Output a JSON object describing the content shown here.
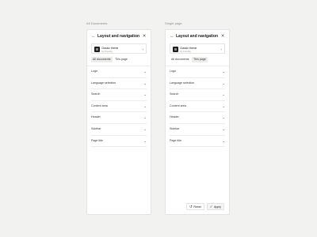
{
  "captions": {
    "left": "All Documents",
    "right": "Single page"
  },
  "panel": {
    "title": "Layout and navigation",
    "back_icon": "arrow-left-icon",
    "close_icon": "close-icon",
    "theme": {
      "name": "Classic theme",
      "author": "by Fouday"
    },
    "tabs": [
      "All documents",
      "This page"
    ],
    "rows": [
      "Logo",
      "Language selection",
      "Search",
      "Content area",
      "Header",
      "Sidebar",
      "Page title"
    ],
    "reset_label": "Reset",
    "apply_label": "Apply"
  },
  "left_panel": {
    "active_tab": 0
  },
  "right_panel": {
    "active_tab": 1
  }
}
